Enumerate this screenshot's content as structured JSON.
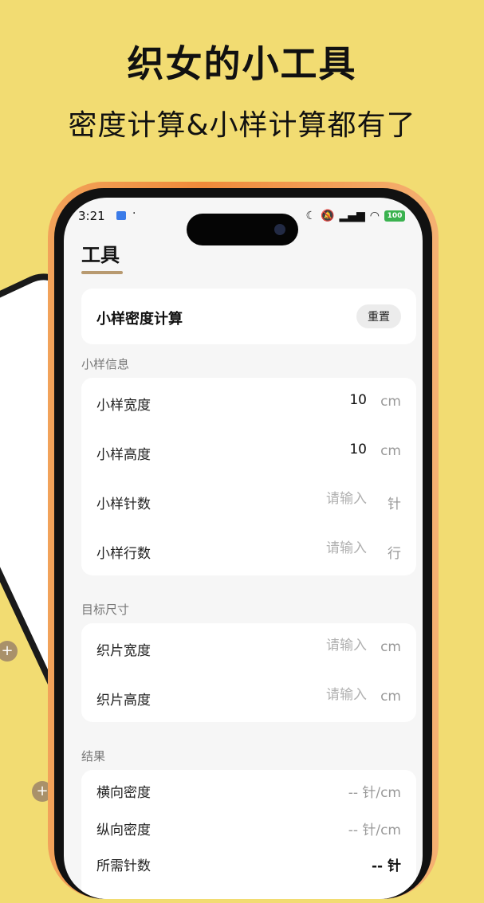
{
  "promo": {
    "headline": "织女的小工具",
    "subheadline": "密度计算&小样计算都有了"
  },
  "status_bar": {
    "time": "3:21",
    "dot": "·",
    "battery": "100"
  },
  "page": {
    "title": "工具"
  },
  "calculator": {
    "title": "小样密度计算",
    "reset_label": "重置"
  },
  "sample": {
    "label": "小样信息",
    "rows": [
      {
        "label": "小样宽度",
        "value": "10",
        "placeholder": "请输入",
        "unit": "cm"
      },
      {
        "label": "小样高度",
        "value": "10",
        "placeholder": "请输入",
        "unit": "cm"
      },
      {
        "label": "小样针数",
        "value": "",
        "placeholder": "请输入",
        "unit": "针"
      },
      {
        "label": "小样行数",
        "value": "",
        "placeholder": "请输入",
        "unit": "行"
      }
    ]
  },
  "target": {
    "label": "目标尺寸",
    "rows": [
      {
        "label": "织片宽度",
        "value": "",
        "placeholder": "请输入",
        "unit": "cm"
      },
      {
        "label": "织片高度",
        "value": "",
        "placeholder": "请输入",
        "unit": "cm"
      }
    ]
  },
  "result": {
    "label": "结果",
    "rows": [
      {
        "label": "横向密度",
        "value": "-- 针/cm"
      },
      {
        "label": "纵向密度",
        "value": "-- 针/cm"
      },
      {
        "label": "所需针数",
        "value": "-- 针"
      }
    ]
  },
  "colors": {
    "background": "#f2dc72",
    "accent": "#b89a70",
    "frame": "#ef8a3a"
  }
}
